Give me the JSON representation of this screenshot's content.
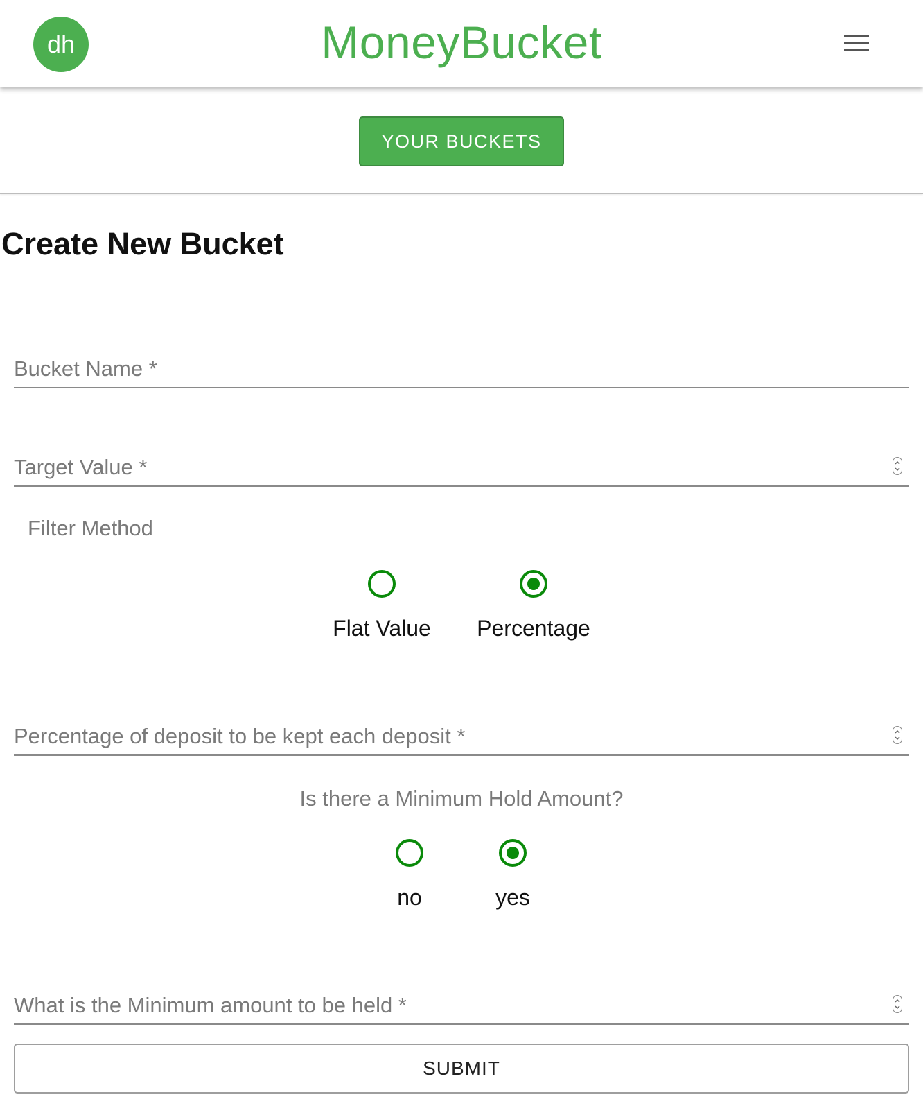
{
  "header": {
    "avatar_initials": "dh",
    "app_title": "MoneyBucket",
    "menu_icon": "hamburger-menu-icon"
  },
  "nav": {
    "your_buckets_label": "YOUR BUCKETS"
  },
  "page_title": "Create New Bucket",
  "form": {
    "bucket_name": {
      "label": "Bucket Name *",
      "value": ""
    },
    "target_value": {
      "label": "Target Value *",
      "value": ""
    },
    "filter_method": {
      "label": "Filter Method",
      "options": [
        {
          "label": "Flat Value",
          "checked": false
        },
        {
          "label": "Percentage",
          "checked": true
        }
      ]
    },
    "percentage_of_deposit": {
      "label": "Percentage of deposit to be kept each deposit *",
      "value": ""
    },
    "minimum_hold": {
      "question": "Is there a Minimum Hold Amount?",
      "options": [
        {
          "label": "no",
          "checked": false
        },
        {
          "label": "yes",
          "checked": true
        }
      ]
    },
    "minimum_amount": {
      "label": "What is the Minimum amount to be held *",
      "value": ""
    },
    "submit_label": "SUBMIT"
  },
  "colors": {
    "brand_green": "#4caf50",
    "radio_green": "#0a8a0a"
  }
}
